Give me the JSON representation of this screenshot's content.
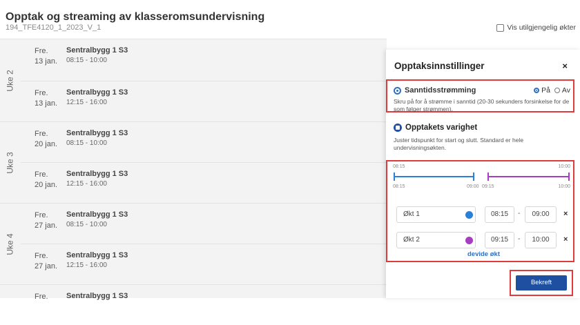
{
  "header": {
    "title": "Opptak og streaming av klasseromsundervisning",
    "subtitle": "194_TFE4120_1_2023_V_1",
    "show_unavailable_label": "Vis utilgjengelig økter"
  },
  "weeks": [
    {
      "label": "Uke 2",
      "sessions": [
        {
          "day": "Fre.",
          "date": "13 jan.",
          "location": "Sentralbygg 1 S3",
          "time": "08:15 - 10:00"
        },
        {
          "day": "Fre.",
          "date": "13 jan.",
          "location": "Sentralbygg 1 S3",
          "time": "12:15 - 16:00"
        }
      ]
    },
    {
      "label": "Uke 3",
      "sessions": [
        {
          "day": "Fre.",
          "date": "20 jan.",
          "location": "Sentralbygg 1 S3",
          "time": "08:15 - 10:00"
        },
        {
          "day": "Fre.",
          "date": "20 jan.",
          "location": "Sentralbygg 1 S3",
          "time": "12:15 - 16:00"
        }
      ]
    },
    {
      "label": "Uke 4",
      "sessions": [
        {
          "day": "Fre.",
          "date": "27 jan.",
          "location": "Sentralbygg 1 S3",
          "time": "08:15 - 10:00"
        },
        {
          "day": "Fre.",
          "date": "27 jan.",
          "location": "Sentralbygg 1 S3",
          "time": "12:15 - 16:00"
        }
      ]
    },
    {
      "label": "",
      "sessions": [
        {
          "day": "Fre.",
          "date": "",
          "location": "Sentralbygg 1 S3",
          "time": ""
        }
      ]
    }
  ],
  "panel": {
    "title": "Opptaksinnstillinger",
    "close_icon": "×",
    "streaming": {
      "title": "Sanntidsstrømming",
      "on_label": "På",
      "off_label": "Av",
      "selected": "on",
      "description": "Skru på for å strømme i sanntid (20-30 sekunders forsinkelse for de som følger strømmen)."
    },
    "duration": {
      "title": "Opptakets varighet",
      "description": "Juster tidspunkt for start og slutt. Standard er hele undervisningsøkten."
    },
    "timeline": {
      "top_start": "08:15",
      "top_end": "10:00",
      "bottom_start": "08:15",
      "bottom_mid_a": "09:00",
      "bottom_mid_b": "09:15",
      "bottom_end": "10:00"
    },
    "segments": [
      {
        "name": "Økt 1",
        "color": "#2a7fd8",
        "start": "08:15",
        "end": "09:00"
      },
      {
        "name": "Økt 2",
        "color": "#a53ec0",
        "start": "09:15",
        "end": "10:00"
      }
    ],
    "separator": "-",
    "remove_icon": "×",
    "split_label": "devide økt",
    "confirm_label": "Bekreft"
  },
  "colors": {
    "accent": "#1e4fa0",
    "highlight": "#e03a3a",
    "segment_1": "#2a7fd8",
    "segment_2": "#a53ec0"
  }
}
